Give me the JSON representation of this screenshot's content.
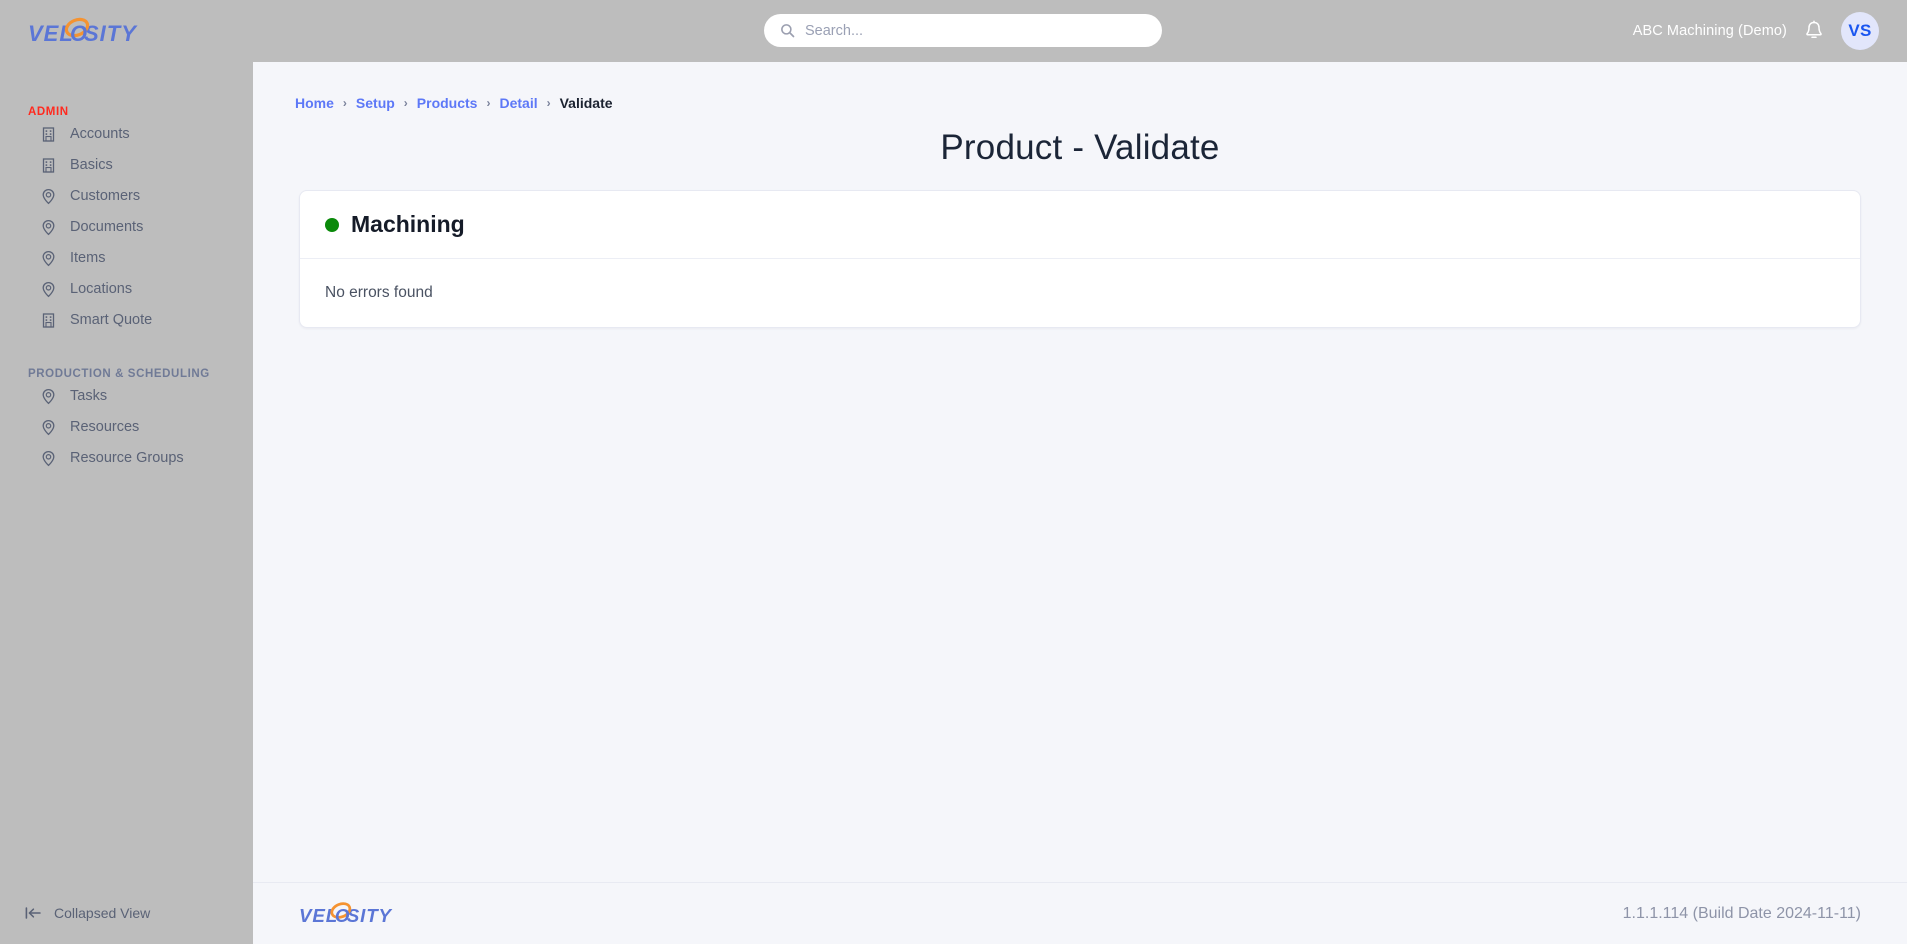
{
  "app": {
    "logo_text": "VELOSITY",
    "logo_colors": {
      "text": "#5b76d6",
      "accent": "#f59331"
    }
  },
  "header": {
    "search": {
      "placeholder": "Search...",
      "value": "",
      "icon": "search-icon"
    },
    "account_name": "ABC Machining (Demo)",
    "notification_icon": "bell-icon",
    "avatar_initials": "VS"
  },
  "sidebar": {
    "sections": [
      {
        "label": "ADMIN",
        "color": "#ff2a1f",
        "items": [
          {
            "label": "Accounts",
            "icon": "building-icon"
          },
          {
            "label": "Basics",
            "icon": "building-icon"
          },
          {
            "label": "Customers",
            "icon": "map-pin-icon"
          },
          {
            "label": "Documents",
            "icon": "map-pin-icon"
          },
          {
            "label": "Items",
            "icon": "map-pin-icon"
          },
          {
            "label": "Locations",
            "icon": "map-pin-icon"
          },
          {
            "label": "Smart Quote",
            "icon": "building-icon"
          }
        ]
      },
      {
        "label": "PRODUCTION & SCHEDULING",
        "color": "#707a96",
        "items": [
          {
            "label": "Tasks",
            "icon": "map-pin-icon"
          },
          {
            "label": "Resources",
            "icon": "map-pin-icon"
          },
          {
            "label": "Resource Groups",
            "icon": "map-pin-icon"
          }
        ]
      }
    ],
    "collapse": {
      "label": "Collapsed View",
      "icon": "collapse-left-icon"
    }
  },
  "main": {
    "breadcrumb": [
      {
        "label": "Home",
        "active": false
      },
      {
        "label": "Setup",
        "active": false
      },
      {
        "label": "Products",
        "active": false
      },
      {
        "label": "Detail",
        "active": false
      },
      {
        "label": "Validate",
        "active": true
      }
    ],
    "breadcrumb_separator": "›",
    "title": "Product - Validate",
    "card": {
      "status_color": "#0a8a0a",
      "title": "Machining",
      "body_text": "No errors found"
    }
  },
  "footer": {
    "logo_text": "VELOSITY",
    "version": "1.1.1.114 (Build Date 2024-11-11)"
  }
}
